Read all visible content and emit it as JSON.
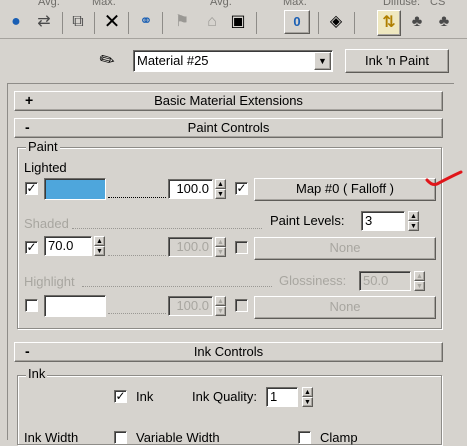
{
  "toolbar": {
    "labels": [
      "Avg.",
      "Max.",
      "Avg.",
      "Max.",
      "Diffuse:",
      "CS"
    ]
  },
  "material": {
    "name": "Material #25",
    "type_button": "Ink 'n Paint"
  },
  "rollouts": {
    "basic": {
      "sign": "+",
      "title": "Basic Material Extensions"
    },
    "paint": {
      "sign": "-",
      "title": "Paint Controls"
    },
    "ink": {
      "sign": "-",
      "title": "Ink Controls"
    }
  },
  "paint": {
    "group_label": "Paint",
    "lighted": {
      "label": "Lighted",
      "checked": "✓",
      "color": "#4ea6dc",
      "amount": "100.0",
      "map_checked": "✓",
      "map_button": "Map #0  ( Falloff )"
    },
    "shaded": {
      "label": "Shaded",
      "checked": "✓",
      "value": "70.0",
      "amount": "100.0",
      "map_button": "None"
    },
    "paint_levels": {
      "label": "Paint Levels:",
      "value": "3"
    },
    "highlight": {
      "label": "Highlight",
      "color": "#ffffff",
      "amount": "100.0",
      "map_button": "None"
    },
    "glossiness": {
      "label": "Glossiness:",
      "value": "50.0"
    }
  },
  "ink": {
    "group_label": "Ink",
    "ink_checkbox": {
      "label": "Ink",
      "checked": "✓"
    },
    "ink_quality": {
      "label": "Ink Quality:",
      "value": "1"
    },
    "bottom_row": {
      "label1": "Ink Width",
      "label2": "Variable Width",
      "label3": "Clamp"
    }
  },
  "annotation_color": "#e0161a"
}
